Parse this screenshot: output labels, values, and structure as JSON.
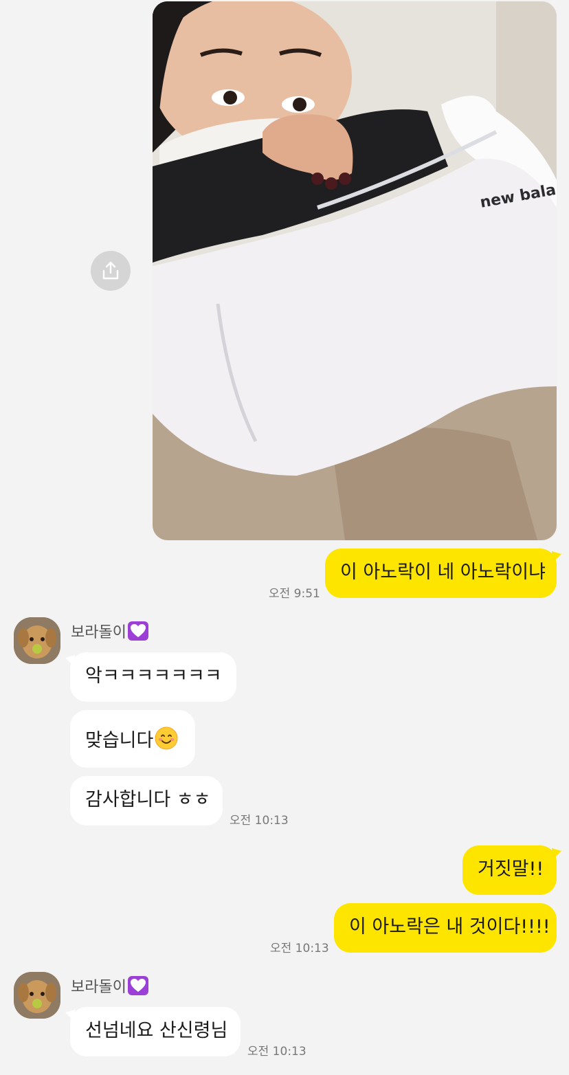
{
  "colors": {
    "background": "#f3f3f3",
    "my_bubble": "#fee500",
    "their_bubble": "#ffffff",
    "timestamp": "#777777"
  },
  "photo_message": {
    "brand_text": "new bala",
    "share_icon": "share-icon"
  },
  "messages": [
    {
      "text": "이 아노락이 네 아노락이냐",
      "time": "오전 9:51"
    },
    {
      "sender": "보라돌이"
    },
    {
      "text": "악ㅋㅋㅋㅋㅋㅋㅋ"
    },
    {
      "text": "맞습니다",
      "emoji": "smiling-face-emoji"
    },
    {
      "text": "감사합니다 ㅎㅎ",
      "time": "오전 10:13"
    },
    {
      "text": "거짓말!!"
    },
    {
      "text": "이 아노락은 내 것이다!!!!",
      "time": "오전 10:13"
    },
    {
      "sender": "보라돌이"
    },
    {
      "text": "선넘네요 산신령님",
      "time": "오전 10:13"
    }
  ]
}
